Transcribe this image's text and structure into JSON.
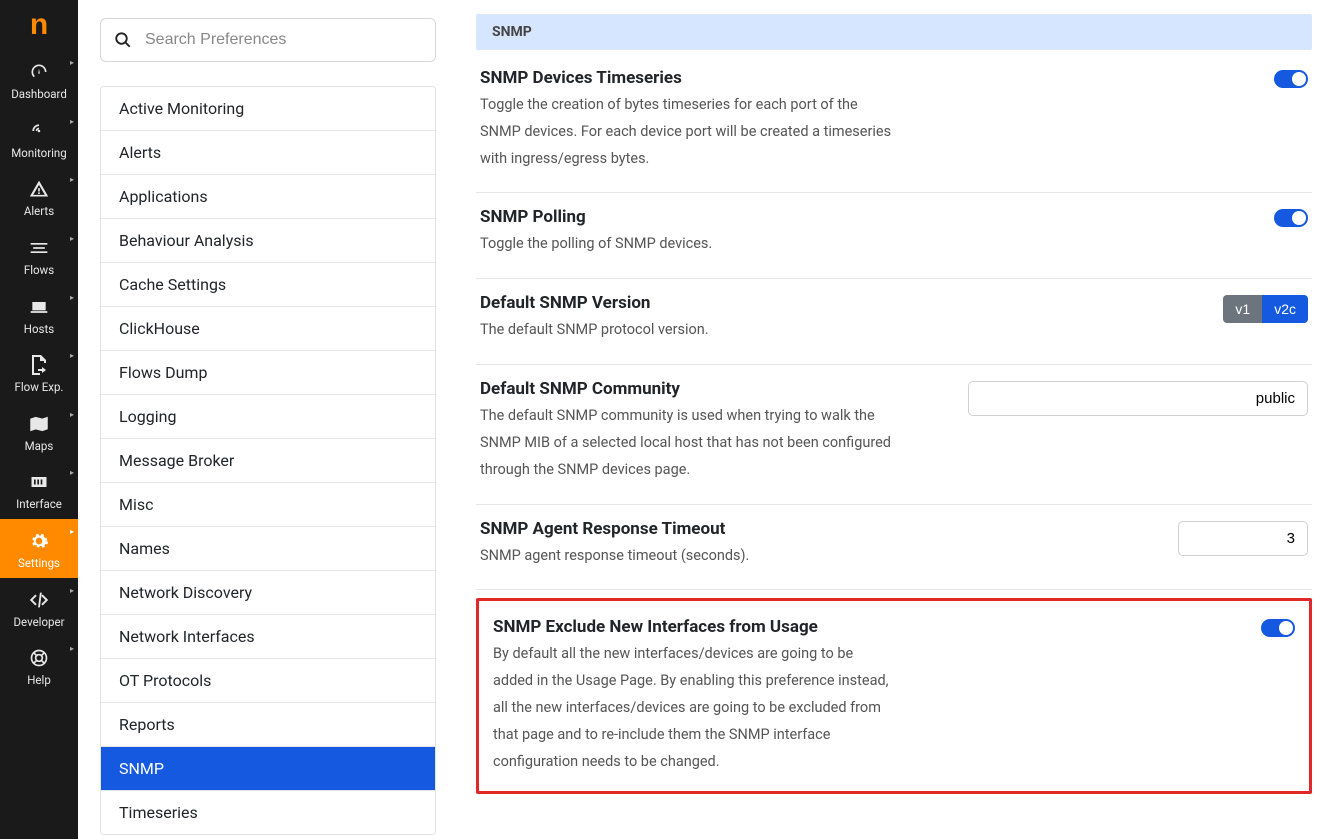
{
  "logo": "n",
  "nav": [
    {
      "label": "Dashboard"
    },
    {
      "label": "Monitoring"
    },
    {
      "label": "Alerts"
    },
    {
      "label": "Flows"
    },
    {
      "label": "Hosts"
    },
    {
      "label": "Flow Exp."
    },
    {
      "label": "Maps"
    },
    {
      "label": "Interface"
    },
    {
      "label": "Settings",
      "active": true
    },
    {
      "label": "Developer"
    },
    {
      "label": "Help"
    }
  ],
  "search": {
    "placeholder": "Search Preferences"
  },
  "prefs": [
    "Active Monitoring",
    "Alerts",
    "Applications",
    "Behaviour Analysis",
    "Cache Settings",
    "ClickHouse",
    "Flows Dump",
    "Logging",
    "Message Broker",
    "Misc",
    "Names",
    "Network Discovery",
    "Network Interfaces",
    "OT Protocols",
    "Reports",
    "SNMP",
    "Timeseries"
  ],
  "prefs_selected": "SNMP",
  "section_title": "SNMP",
  "settings": {
    "timeseries": {
      "title": "SNMP Devices Timeseries",
      "desc": "Toggle the creation of bytes timeseries for each port of the SNMP devices. For each device port will be created a timeseries with ingress/egress bytes."
    },
    "polling": {
      "title": "SNMP Polling",
      "desc": "Toggle the polling of SNMP devices."
    },
    "version": {
      "title": "Default SNMP Version",
      "desc": "The default SNMP protocol version.",
      "v1": "v1",
      "v2c": "v2c"
    },
    "community": {
      "title": "Default SNMP Community",
      "desc": "The default SNMP community is used when trying to walk the SNMP MIB of a selected local host that has not been configured through the SNMP devices page.",
      "value": "public"
    },
    "timeout": {
      "title": "SNMP Agent Response Timeout",
      "desc": "SNMP agent response timeout (seconds).",
      "value": "3"
    },
    "exclude": {
      "title": "SNMP Exclude New Interfaces from Usage",
      "desc": "By default all the new interfaces/devices are going to be added in the Usage Page. By enabling this preference instead, all the new interfaces/devices are going to be excluded from that page and to re-include them the SNMP interface configuration needs to be changed."
    }
  }
}
